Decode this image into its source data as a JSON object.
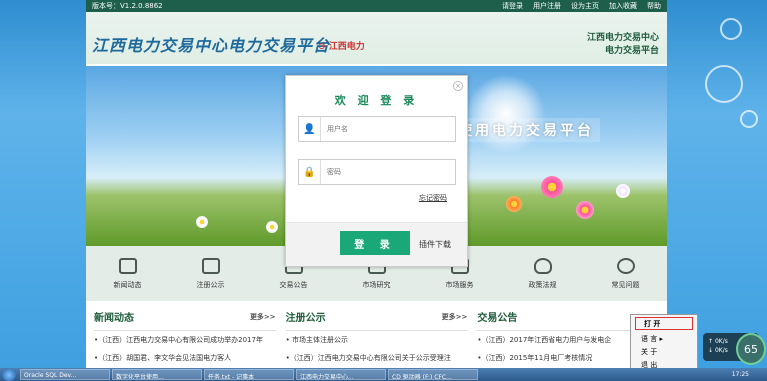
{
  "topbar": {
    "version": "版本号：V1.2.0.8862",
    "links": [
      "请登录",
      "用户注册",
      "设为主页",
      "加入收藏",
      "帮助"
    ]
  },
  "header": {
    "brand": "江西电力交易中心电力交易平台",
    "region": "江西电力",
    "right_line1": "江西电力交易中心",
    "right_line2": "电力交易平台"
  },
  "banner": {
    "text": "使用电力交易平台"
  },
  "login": {
    "title": "欢 迎 登 录",
    "username_placeholder": "用户名",
    "password_placeholder": "密码",
    "forgot": "忘记密码",
    "login_button": "登 录",
    "plugin": "插件下载"
  },
  "nav": [
    {
      "label": "新闻动态"
    },
    {
      "label": "注册公示"
    },
    {
      "label": "交易公告"
    },
    {
      "label": "市场研究"
    },
    {
      "label": "市场服务"
    },
    {
      "label": "政策法规"
    },
    {
      "label": "常见问题"
    }
  ],
  "columns": [
    {
      "title": "新闻动态",
      "more": "更多>>",
      "items": [
        "•（江西）江西电力交易中心有限公司成功举办2017年",
        "•（江西）胡国君、李文华会见法国电力客人"
      ]
    },
    {
      "title": "注册公示",
      "more": "更多>>",
      "items": [
        "• 市场主体注册公示",
        "•（江西）江西电力交易中心有限公司关于公示受理注"
      ]
    },
    {
      "title": "交易公告",
      "more": "",
      "items": [
        "•（江西）2017年江西省电力用户与发电企",
        "•（江西）2015年11月电厂考核情况"
      ]
    }
  ],
  "context_menu": [
    "打 开",
    "语 言",
    "关 于",
    "退 出"
  ],
  "taskbar": {
    "items": [
      "Oracle SQL Dev...",
      "数字化平台使用...",
      "任务.txt - 记事本",
      "江西电力交易中心...",
      "CD 驱动器 (F:) CFC..."
    ],
    "clock": "17:25"
  },
  "speed": {
    "up": "0K/s",
    "down": "0K/s",
    "gauge": "65"
  }
}
